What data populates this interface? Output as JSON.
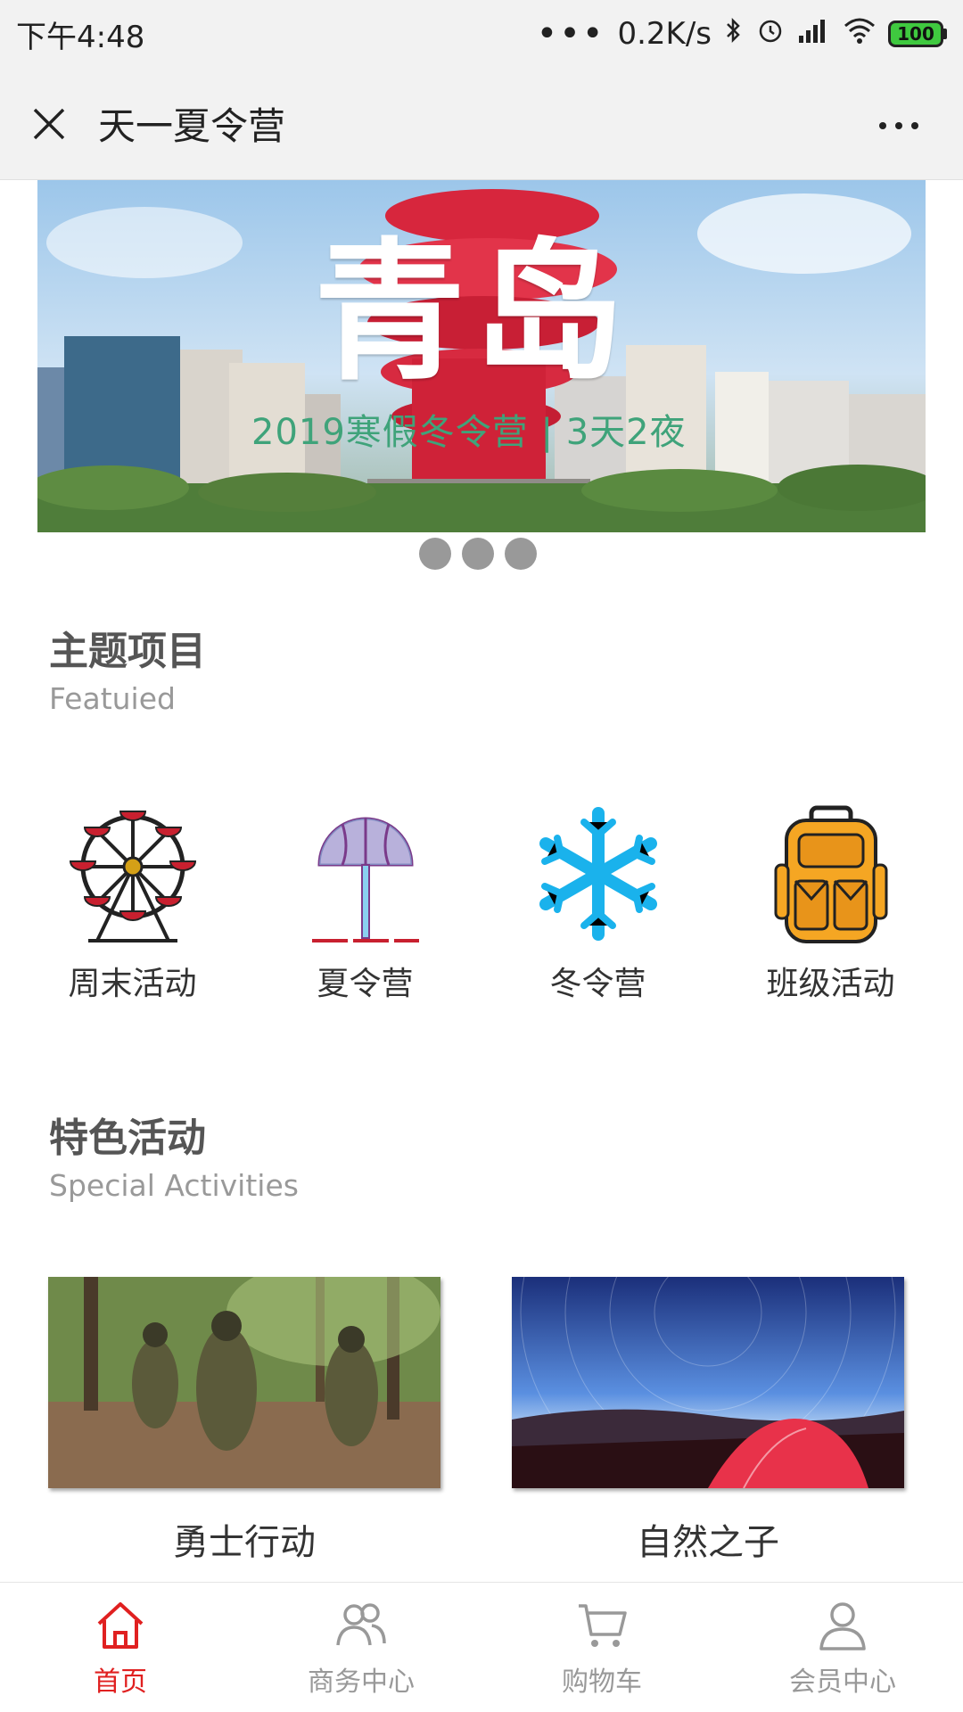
{
  "status": {
    "time": "下午4:48",
    "network_speed": "0.2K/s",
    "battery": "100"
  },
  "navbar": {
    "title": "天一夏令营"
  },
  "banner": {
    "title": "青岛",
    "subtitle": "2019寒假冬令营 | 3天2夜"
  },
  "featured": {
    "title": "主题项目",
    "subtitle": "Featuied",
    "items": [
      {
        "label": "周末活动",
        "icon": "ferris-wheel-icon"
      },
      {
        "label": "夏令营",
        "icon": "umbrella-icon"
      },
      {
        "label": "冬令营",
        "icon": "snowflake-icon"
      },
      {
        "label": "班级活动",
        "icon": "backpack-icon"
      }
    ]
  },
  "special": {
    "title": "特色活动",
    "subtitle": "Special Activities",
    "items": [
      {
        "label": "勇士行动"
      },
      {
        "label": "自然之子"
      }
    ]
  },
  "tabbar": {
    "items": [
      {
        "label": "首页",
        "active": true
      },
      {
        "label": "商务中心"
      },
      {
        "label": "购物车"
      },
      {
        "label": "会员中心"
      }
    ],
    "active_color": "#e02020",
    "inactive_color": "#999999"
  }
}
